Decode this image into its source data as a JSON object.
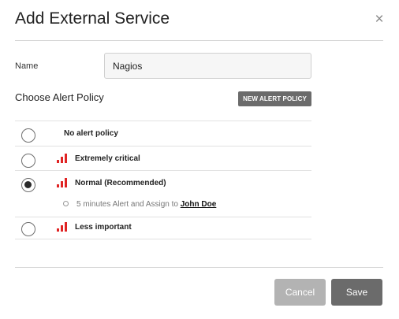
{
  "dialog": {
    "title": "Add External Service",
    "close_glyph": "×"
  },
  "name_field": {
    "label": "Name",
    "value": "Nagios"
  },
  "policy": {
    "heading": "Choose Alert Policy",
    "new_button_label": "NEW ALERT POLICY",
    "options": [
      {
        "label": "No alert policy",
        "selected": false,
        "icon": "none"
      },
      {
        "label": "Extremely critical",
        "selected": false,
        "icon": "signal-bars-icon"
      },
      {
        "label": "Normal (Recommended)",
        "selected": true,
        "icon": "signal-bars-icon",
        "detail": {
          "text": "5 minutes Alert and Assign to ",
          "user": "John Doe"
        }
      },
      {
        "label": "Less important",
        "selected": false,
        "icon": "signal-bars-icon"
      }
    ]
  },
  "footer": {
    "cancel_label": "Cancel",
    "save_label": "Save"
  },
  "colors": {
    "severity_icon": "#e02424",
    "primary_button": "#6b6b6b",
    "secondary_button": "#b3b3b3"
  }
}
